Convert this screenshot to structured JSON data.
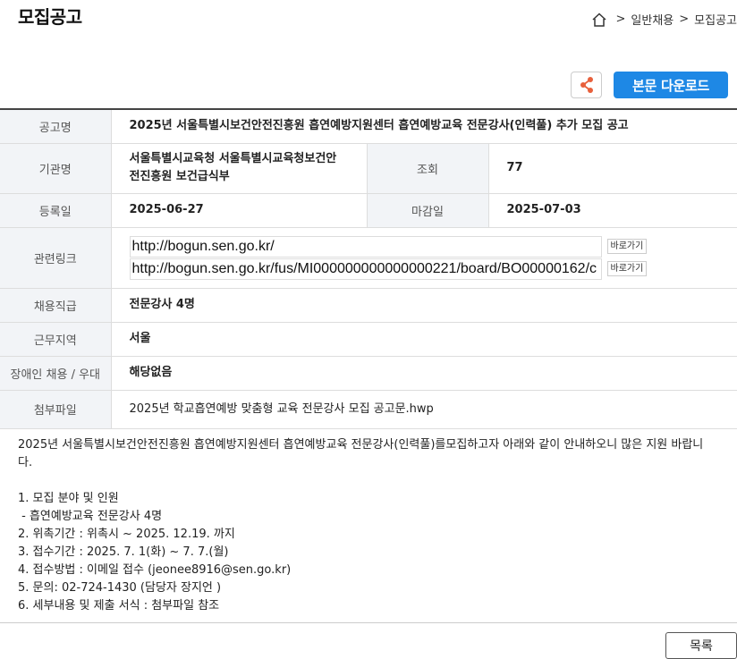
{
  "header": {
    "title": "모집공고",
    "breadcrumb": [
      "일반채용",
      "모집공고"
    ]
  },
  "toolbar": {
    "download_label": "본문 다운로드"
  },
  "info": {
    "title_label": "공고명",
    "title_value": "2025년 서울특별시보건안전진흥원 흡연예방지원센터 흡연예방교육 전문강사(인력풀) 추가 모집 공고",
    "org_label": "기관명",
    "org_value_line1": "서울특별시교육청 서울특별시교육청보건안",
    "org_value_line2": "전진흥원 보건급식부",
    "views_label": "조회",
    "views_value": "77",
    "reg_label": "등록일",
    "reg_value": "2025-06-27",
    "deadline_label": "마감일",
    "deadline_value": "2025-07-03",
    "links_label": "관련링크",
    "links": [
      {
        "url": "http://bogun.sen.go.kr/",
        "go": "바로가기"
      },
      {
        "url": "http://bogun.sen.go.kr/fus/MI000000000000000221/board/BO00000162/c",
        "go": "바로가기"
      }
    ],
    "position_label": "채용직급",
    "position_value": "전문강사 4명",
    "region_label": "근무지역",
    "region_value": "서울",
    "disabled_label": "장애인 채용 / 우대",
    "disabled_value": "해당없음",
    "attach_label": "첨부파일",
    "attach_value": "2025년 학교흡연예방 맞춤형 교육 전문강사 모집 공고문.hwp"
  },
  "content": {
    "intro_line1": "2025년 서울특별시보건안전진흥원 흡연예방지원센터 흡연예방교육 전문강사(인력풀)를모집하고자 아래와 같이 안내하오니 많은 지원 바랍니",
    "intro_line2": "다.",
    "items": [
      "1. 모집 분야 및 인원",
      " - 흡연예방교육 전문강사 4명",
      "2. 위촉기간 : 위촉시 ~ 2025. 12.19. 까지",
      "3. 접수기간 : 2025. 7. 1(화) ~ 7. 7.(월)",
      "4. 접수방법 : 이메일 접수 (jeonee8916@sen.go.kr)",
      "5. 문의: 02-724-1430 (담당자 장지언 )",
      "6. 세부내용 및 제출 서식 : 첨부파일 참조"
    ]
  },
  "footer": {
    "list_label": "목록"
  },
  "colors": {
    "accent": "#1e88e5",
    "share_icon": "#e8603c",
    "header_cell": "#f2f4f7"
  }
}
